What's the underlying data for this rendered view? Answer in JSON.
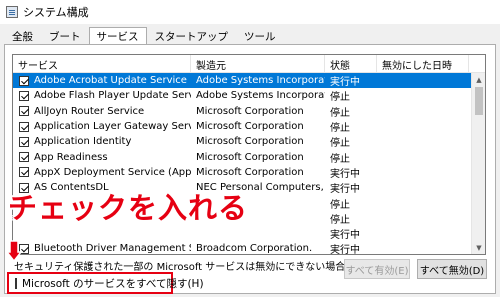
{
  "window": {
    "title": "システム構成"
  },
  "tabs": [
    {
      "label": "全般",
      "active": false
    },
    {
      "label": "ブート",
      "active": false
    },
    {
      "label": "サービス",
      "active": true
    },
    {
      "label": "スタートアップ",
      "active": false
    },
    {
      "label": "ツール",
      "active": false
    }
  ],
  "table": {
    "columns": [
      "サービス",
      "製造元",
      "状態",
      "無効にした日時"
    ],
    "rows": [
      {
        "service": "Adobe Acrobat Update Service",
        "vendor": "Adobe Systems Incorporated",
        "status": "実行中",
        "checked": true,
        "selected": true
      },
      {
        "service": "Adobe Flash Player Update Service",
        "vendor": "Adobe Systems Incorporated",
        "status": "停止",
        "checked": true
      },
      {
        "service": "AllJoyn Router Service",
        "vendor": "Microsoft Corporation",
        "status": "停止",
        "checked": true
      },
      {
        "service": "Application Layer Gateway Service",
        "vendor": "Microsoft Corporation",
        "status": "停止",
        "checked": true
      },
      {
        "service": "Application Identity",
        "vendor": "Microsoft Corporation",
        "status": "停止",
        "checked": true
      },
      {
        "service": "App Readiness",
        "vendor": "Microsoft Corporation",
        "status": "停止",
        "checked": true
      },
      {
        "service": "AppX Deployment Service (AppXSVC)",
        "vendor": "Microsoft Corporation",
        "status": "実行中",
        "checked": true
      },
      {
        "service": "AS ContentsDL",
        "vendor": "NEC Personal Computers, Ltd.",
        "status": "実行中",
        "checked": true
      },
      {
        "service": "",
        "vendor": "",
        "status": "停止",
        "checked": false
      },
      {
        "service": "",
        "vendor": "",
        "status": "停止",
        "checked": false
      },
      {
        "service": "",
        "vendor": "",
        "status": "実行中",
        "checked": false
      },
      {
        "service": "Bluetooth Driver Management Service",
        "vendor": "Broadcom Corporation.",
        "status": "実行中",
        "checked": true
      }
    ]
  },
  "annotation": {
    "text": "チェックを入れる",
    "color": "#e60012"
  },
  "footer": {
    "note": "セキュリティ保護された一部の Microsoft サービスは無効にできない場合があります。",
    "enable_all": "すべて有効(E)",
    "disable_all": "すべて無効(D)",
    "hide_ms_label": "Microsoft のサービスをすべて隠す(H)"
  },
  "colors": {
    "selection": "#0078d7",
    "annotation": "#e60012"
  }
}
